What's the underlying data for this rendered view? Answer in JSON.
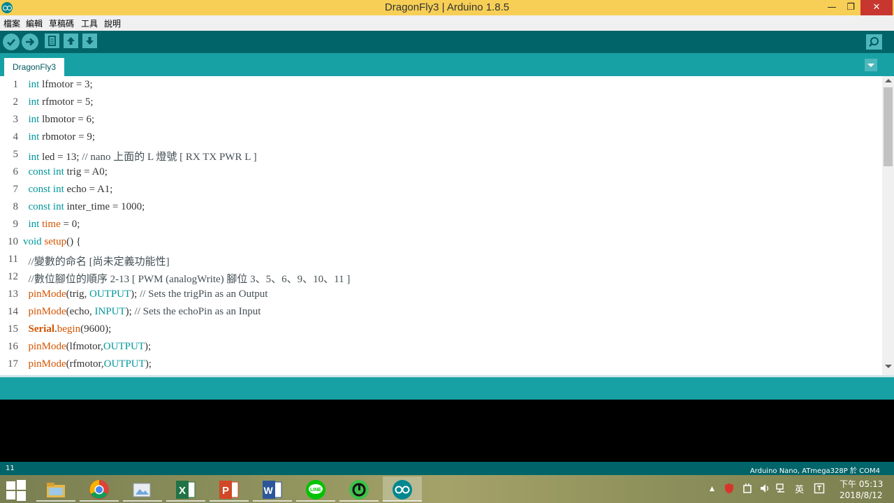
{
  "window": {
    "title": "DragonFly3 | Arduino 1.8.5",
    "minimize": "—",
    "maximize": "❐",
    "close": "✕"
  },
  "menu": [
    "檔案",
    "編輯",
    "草稿碼",
    "工具",
    "說明"
  ],
  "toolbar": {
    "verify": "verify-icon",
    "upload": "upload-icon",
    "new": "new-icon",
    "open": "open-icon",
    "save": "save-icon",
    "serial_monitor": "serial-monitor-icon"
  },
  "tabs": [
    {
      "label": "DragonFly3"
    }
  ],
  "editor": {
    "line_numbers": [
      "1",
      "2",
      "3",
      "4",
      "5",
      "6",
      "7",
      "8",
      "9",
      "10",
      "11",
      "12",
      "13",
      "14",
      "15",
      "16",
      "17"
    ],
    "lines": [
      [
        {
          "t": "  "
        },
        {
          "t": "int",
          "c": "kw"
        },
        {
          "t": " lfmotor = 3;"
        }
      ],
      [
        {
          "t": "  "
        },
        {
          "t": "int",
          "c": "kw"
        },
        {
          "t": " rfmotor = 5;"
        }
      ],
      [
        {
          "t": "  "
        },
        {
          "t": "int",
          "c": "kw"
        },
        {
          "t": " lbmotor = 6;"
        }
      ],
      [
        {
          "t": "  "
        },
        {
          "t": "int",
          "c": "kw"
        },
        {
          "t": " rbmotor = 9;"
        }
      ],
      [
        {
          "t": "  "
        },
        {
          "t": "int",
          "c": "kw"
        },
        {
          "t": " led = 13; "
        },
        {
          "t": "// nano 上面的 L 燈號 [ RX TX PWR L ]",
          "c": "cmt"
        }
      ],
      [
        {
          "t": "  "
        },
        {
          "t": "const",
          "c": "kw"
        },
        {
          "t": " "
        },
        {
          "t": "int",
          "c": "kw"
        },
        {
          "t": " trig = A0;"
        }
      ],
      [
        {
          "t": "  "
        },
        {
          "t": "const",
          "c": "kw"
        },
        {
          "t": " "
        },
        {
          "t": "int",
          "c": "kw"
        },
        {
          "t": " echo = A1;"
        }
      ],
      [
        {
          "t": "  "
        },
        {
          "t": "const",
          "c": "kw"
        },
        {
          "t": " "
        },
        {
          "t": "int",
          "c": "kw"
        },
        {
          "t": " inter_time = 1000;"
        }
      ],
      [
        {
          "t": "  "
        },
        {
          "t": "int",
          "c": "kw"
        },
        {
          "t": " "
        },
        {
          "t": "time",
          "c": "fn"
        },
        {
          "t": " = 0;"
        }
      ],
      [
        {
          "t": "void",
          "c": "kw"
        },
        {
          "t": " "
        },
        {
          "t": "setup",
          "c": "fn"
        },
        {
          "t": "() {"
        }
      ],
      [
        {
          "t": "  "
        },
        {
          "t": "//變數的命名 [尚未定義功能性]",
          "c": "cmt"
        }
      ],
      [
        {
          "t": "  "
        },
        {
          "t": "//數位腳位的順序 2-13 [ PWM (analogWrite) 腳位 3、5、6、9、10、11 ]",
          "c": "cmt"
        }
      ],
      [
        {
          "t": "  "
        },
        {
          "t": "pinMode",
          "c": "fn"
        },
        {
          "t": "(trig, "
        },
        {
          "t": "OUTPUT",
          "c": "const"
        },
        {
          "t": "); "
        },
        {
          "t": "// Sets the trigPin as an Output",
          "c": "cmt"
        }
      ],
      [
        {
          "t": "  "
        },
        {
          "t": "pinMode",
          "c": "fn"
        },
        {
          "t": "(echo, "
        },
        {
          "t": "INPUT",
          "c": "const"
        },
        {
          "t": "); "
        },
        {
          "t": "// Sets the echoPin as an Input",
          "c": "cmt"
        }
      ],
      [
        {
          "t": "  "
        },
        {
          "t": "Serial",
          "c": "fn-bold"
        },
        {
          "t": "."
        },
        {
          "t": "begin",
          "c": "fn"
        },
        {
          "t": "(9600);"
        }
      ],
      [
        {
          "t": "  "
        },
        {
          "t": "pinMode",
          "c": "fn"
        },
        {
          "t": "(lfmotor,"
        },
        {
          "t": "OUTPUT",
          "c": "const"
        },
        {
          "t": ");"
        }
      ],
      [
        {
          "t": "  "
        },
        {
          "t": "pinMode",
          "c": "fn"
        },
        {
          "t": "(rfmotor,"
        },
        {
          "t": "OUTPUT",
          "c": "const"
        },
        {
          "t": ");"
        }
      ]
    ]
  },
  "footer": {
    "line": "11",
    "board": "Arduino Nano, ATmega328P 於 COM4"
  },
  "taskbar": {
    "apps": [
      {
        "name": "file-explorer",
        "icon": "folder-icon"
      },
      {
        "name": "chrome",
        "icon": "chrome-icon"
      },
      {
        "name": "photo-viewer",
        "icon": "photo-icon"
      },
      {
        "name": "excel",
        "icon": "excel-icon",
        "letter": "X"
      },
      {
        "name": "powerpoint",
        "icon": "powerpoint-icon",
        "letter": "P"
      },
      {
        "name": "word",
        "icon": "word-icon",
        "letter": "W"
      },
      {
        "name": "line",
        "icon": "line-icon",
        "letter": "LINE"
      },
      {
        "name": "app-green",
        "icon": "green-app-icon"
      },
      {
        "name": "arduino",
        "icon": "arduino-icon"
      }
    ],
    "tray": {
      "overflow": "▲",
      "ime": "英"
    },
    "clock": {
      "time": "下午 05:13",
      "date": "2018/8/12"
    }
  },
  "colors": {
    "title_bar": "#f7cf56",
    "toolbar": "#006468",
    "tabbar": "#17a1a5",
    "keyword": "#00979c",
    "function": "#d35400",
    "close": "#c7372f"
  }
}
